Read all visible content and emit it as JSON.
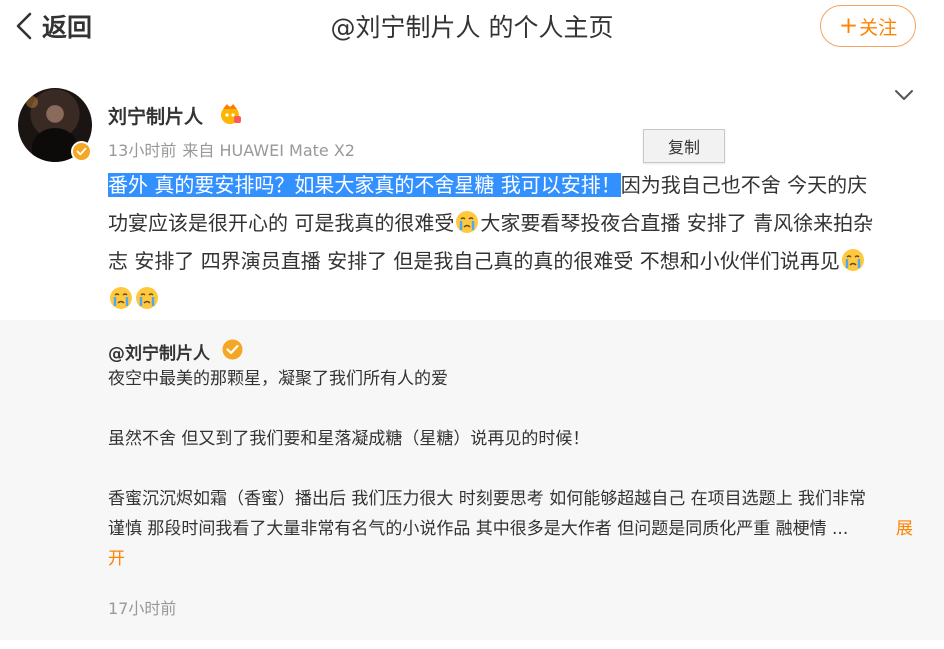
{
  "header": {
    "back_label": "返回",
    "title": "@刘宁制片人 的个人主页",
    "follow_label": "关注",
    "follow_plus": "+"
  },
  "post": {
    "username": "刘宁制片人",
    "time": "13小时前",
    "source": "来自 HUAWEI Mate X2",
    "selected_text": "番外 真的要安排吗？如果大家真的不舍星糖 我可以安排！",
    "text_line1_rest": "因为我自己也不舍 今天的庆",
    "text_line2": "功宴应该是很开心的 可是我真的很难受",
    "text_line2_rest": "大家要看琴投夜合直播 安排了 青风徐来拍杂",
    "text_line3": "志 安排了 四界演员直播 安排了 但是我自己真的真的很难受 不想和小伙伴们说再见",
    "copy_label": "复制"
  },
  "quote": {
    "username": "@刘宁制片人",
    "para1": "夜空中最美的那颗星，凝聚了我们所有人的爱",
    "para2": "虽然不舍 但又到了我们要和星落凝成糖（星糖）说再见的时候！",
    "para3_line1": "香蜜沉沉烬如霜（香蜜）播出后 我们压力很大 时刻要思考 如何能够超越自己 在项目选题上 我们非常",
    "para3_line2": "谨慎 那段时间我看了大量非常有名气的小说作品 其中很多是大作者 但问题是同质化严重 融梗情 ...",
    "expand_label_1": "展",
    "expand_label_2": "开",
    "time": "17小时前"
  },
  "colors": {
    "accent": "#ff8200",
    "selection": "#3390ff",
    "meta": "#999999",
    "quote_bg": "#f7f7f7"
  },
  "icons": [
    "back-chevron-icon",
    "vip-crown-icon",
    "verified-badge-icon",
    "chevron-down-icon",
    "crying-emoji-icon"
  ]
}
